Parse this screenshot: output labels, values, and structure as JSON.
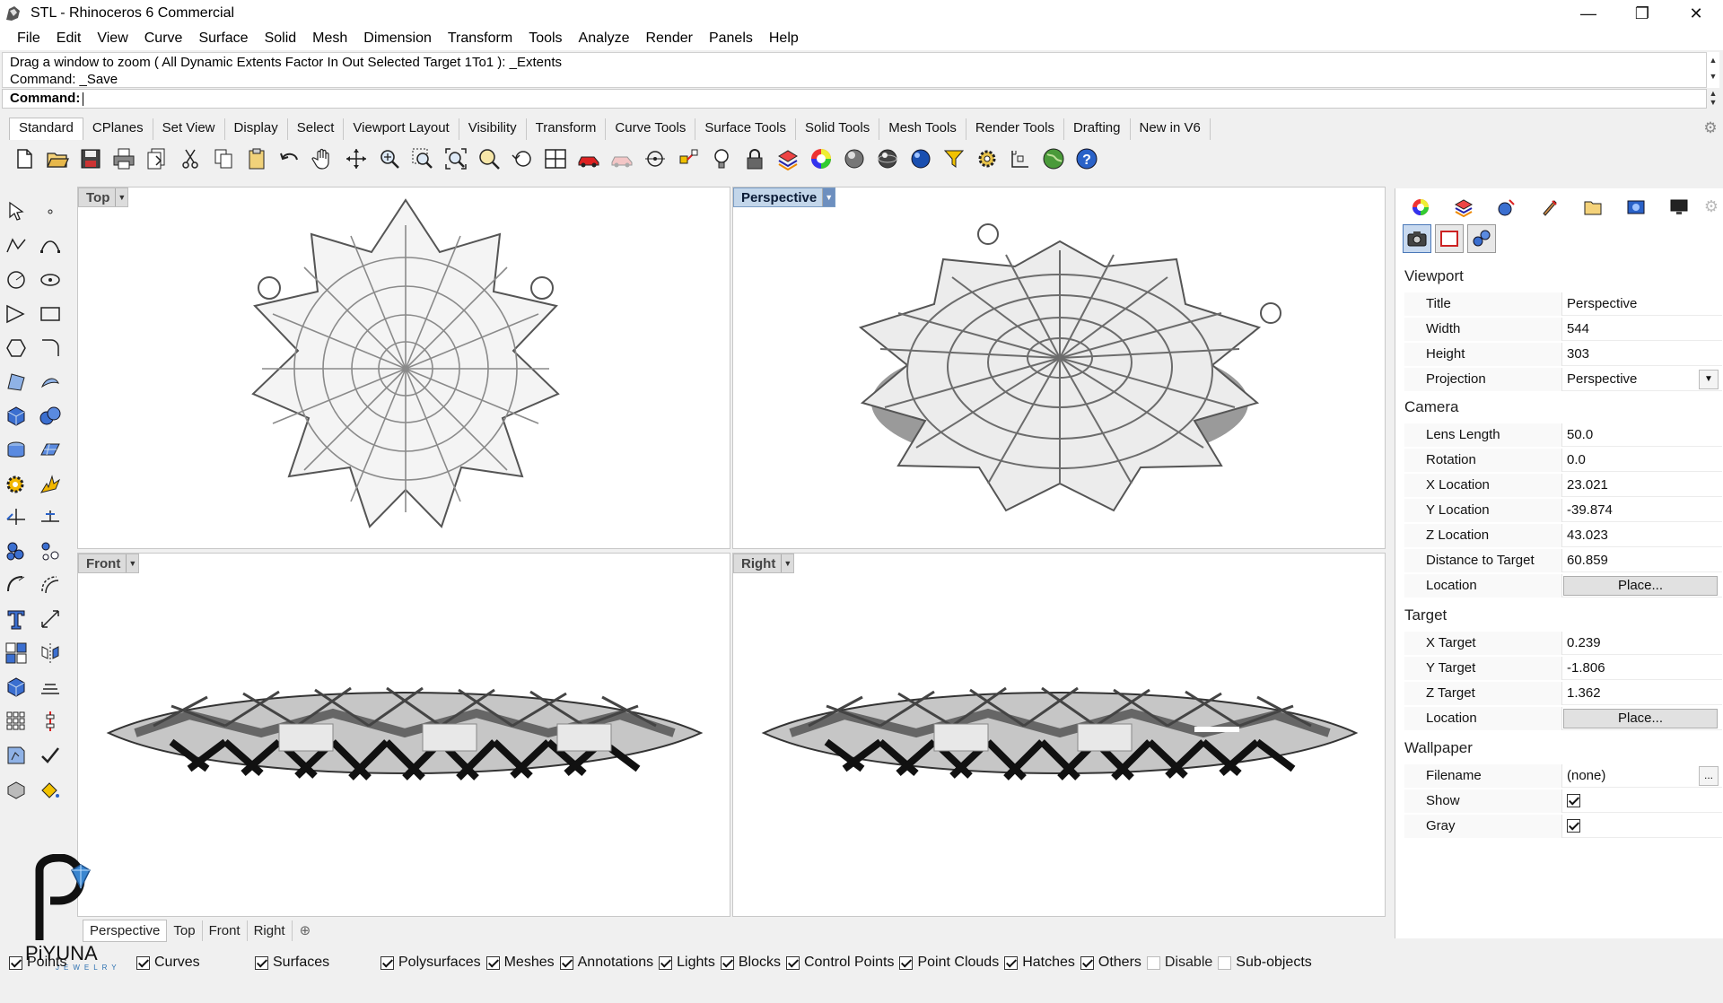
{
  "window": {
    "title": "STL - Rhinoceros 6 Commercial",
    "minimize": "—",
    "restore": "❐",
    "close": "✕"
  },
  "menu": [
    "File",
    "Edit",
    "View",
    "Curve",
    "Surface",
    "Solid",
    "Mesh",
    "Dimension",
    "Transform",
    "Tools",
    "Analyze",
    "Render",
    "Panels",
    "Help"
  ],
  "command": {
    "history_line1": "Drag a window to zoom ( All  Dynamic  Extents  Factor  In  Out  Selected  Target  1To1 ): _Extents",
    "history_line2": "Command: _Save",
    "prompt": "Command:"
  },
  "toolbar_tabs": [
    "Standard",
    "CPlanes",
    "Set View",
    "Display",
    "Select",
    "Viewport Layout",
    "Visibility",
    "Transform",
    "Curve Tools",
    "Surface Tools",
    "Solid Tools",
    "Mesh Tools",
    "Render Tools",
    "Drafting",
    "New in V6"
  ],
  "toolbar_tabs_active": "Standard",
  "viewports": {
    "top": "Top",
    "perspective": "Perspective",
    "front": "Front",
    "right": "Right",
    "active": "Perspective"
  },
  "viewport_tabs": [
    "Perspective",
    "Top",
    "Front",
    "Right"
  ],
  "viewport_tab_add": "⊕",
  "properties": {
    "viewport_title": "Viewport",
    "title_label": "Title",
    "title_value": "Perspective",
    "width_label": "Width",
    "width_value": "544",
    "height_label": "Height",
    "height_value": "303",
    "projection_label": "Projection",
    "projection_value": "Perspective",
    "camera_title": "Camera",
    "lens_label": "Lens Length",
    "lens_value": "50.0",
    "rotation_label": "Rotation",
    "rotation_value": "0.0",
    "xloc_label": "X Location",
    "xloc_value": "23.021",
    "yloc_label": "Y Location",
    "yloc_value": "-39.874",
    "zloc_label": "Z Location",
    "zloc_value": "43.023",
    "dist_label": "Distance to Target",
    "dist_value": "60.859",
    "camloc_label": "Location",
    "camloc_button": "Place...",
    "target_title": "Target",
    "xtarget_label": "X Target",
    "xtarget_value": "0.239",
    "ytarget_label": "Y Target",
    "ytarget_value": "-1.806",
    "ztarget_label": "Z Target",
    "ztarget_value": "1.362",
    "tgtloc_label": "Location",
    "tgtloc_button": "Place...",
    "wallpaper_title": "Wallpaper",
    "filename_label": "Filename",
    "filename_value": "(none)",
    "filename_button": "...",
    "show_label": "Show",
    "show_checked": true,
    "gray_label": "Gray",
    "gray_checked": true
  },
  "osnaps": [
    {
      "label": "Points",
      "checked": true
    },
    {
      "label": "Curves",
      "checked": true
    },
    {
      "label": "Surfaces",
      "checked": true
    },
    {
      "label": "Polysurfaces",
      "checked": true
    },
    {
      "label": "Meshes",
      "checked": true
    },
    {
      "label": "Annotations",
      "checked": true
    },
    {
      "label": "Lights",
      "checked": true
    },
    {
      "label": "Blocks",
      "checked": true
    },
    {
      "label": "Control Points",
      "checked": true
    },
    {
      "label": "Point Clouds",
      "checked": true
    },
    {
      "label": "Hatches",
      "checked": true
    },
    {
      "label": "Others",
      "checked": true
    },
    {
      "label": "Disable",
      "checked": false
    },
    {
      "label": "Sub-objects",
      "checked": false
    }
  ],
  "logo": {
    "name": "PiYUNA",
    "sub": "JEWELRY"
  },
  "colors": {
    "active_viewport": "#c3d6ea",
    "active_subtab": "#c8d9ef",
    "logo_accent": "#2a6fb0"
  }
}
